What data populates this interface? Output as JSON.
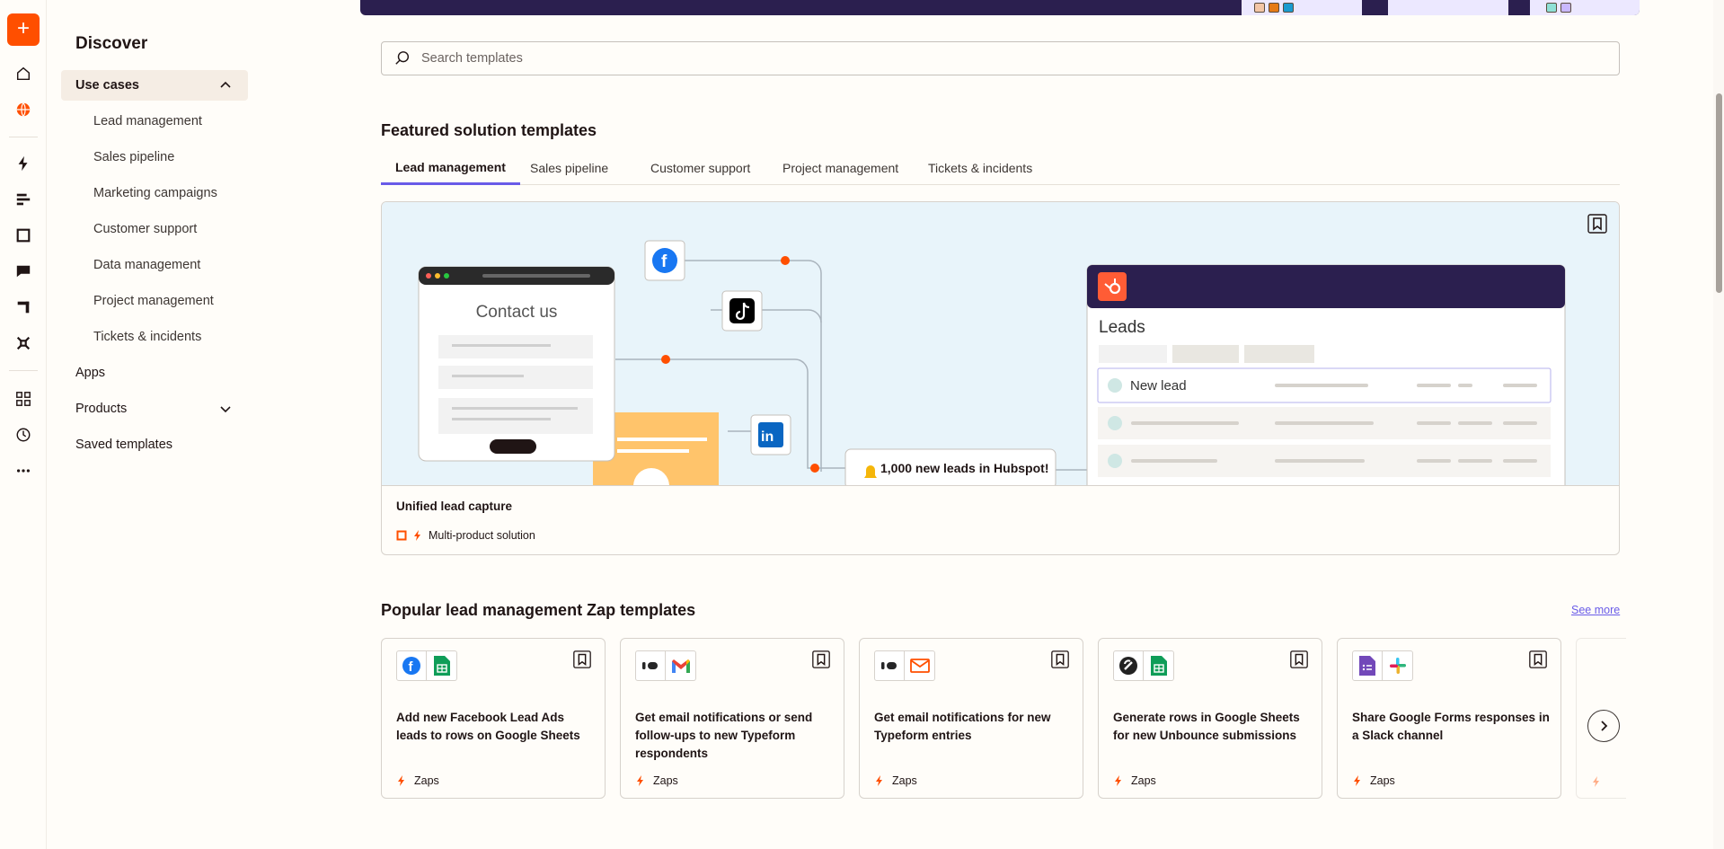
{
  "rail": {
    "create_label": "+",
    "icons": [
      "home-icon",
      "globe-icon",
      "zap-icon",
      "tables-icon",
      "interfaces-icon",
      "chatbots-icon",
      "canvas-icon",
      "agents-icon",
      "apps-grid-icon",
      "history-icon",
      "more-icon"
    ]
  },
  "sidenav": {
    "title": "Discover",
    "use_cases": "Use cases",
    "sub_items": [
      "Lead management",
      "Sales pipeline",
      "Marketing campaigns",
      "Customer support",
      "Data management",
      "Project management",
      "Tickets & incidents"
    ],
    "apps": "Apps",
    "products": "Products",
    "saved": "Saved templates"
  },
  "search": {
    "placeholder": "Search templates"
  },
  "featured": {
    "heading": "Featured solution templates",
    "tabs": [
      "Lead management",
      "Sales pipeline",
      "Customer support",
      "Project management",
      "Tickets & incidents"
    ],
    "card": {
      "art": {
        "form_title": "Contact us",
        "leads_title": "Leads",
        "new_lead": "New lead",
        "notification": "1,000 new leads in Hubspot!"
      },
      "title": "Unified lead capture",
      "meta": "Multi-product solution"
    }
  },
  "popular": {
    "heading": "Popular lead management Zap templates",
    "see_more": "See more",
    "next_label": "›",
    "cards": [
      {
        "apps": [
          "facebook-icon",
          "google-sheets-icon"
        ],
        "title": "Add new Facebook Lead Ads leads to rows on Google Sheets",
        "type": "Zaps"
      },
      {
        "apps": [
          "typeform-icon",
          "gmail-icon"
        ],
        "title": "Get email notifications or send follow-ups to new Typeform respondents",
        "type": "Zaps"
      },
      {
        "apps": [
          "typeform-icon",
          "email-icon"
        ],
        "title": "Get email notifications for new Typeform entries",
        "type": "Zaps"
      },
      {
        "apps": [
          "unbounce-icon",
          "google-sheets-icon"
        ],
        "title": "Generate rows in Google Sheets for new Unbounce submissions",
        "type": "Zaps"
      },
      {
        "apps": [
          "google-forms-icon",
          "slack-icon"
        ],
        "title": "Share Google Forms responses in a Slack channel",
        "type": "Zaps"
      }
    ]
  },
  "colors": {
    "brand": "#ff4f00",
    "accent": "#695be8",
    "dark": "#2b1f4f"
  }
}
